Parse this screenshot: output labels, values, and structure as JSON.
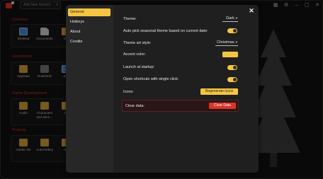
{
  "topbar": {
    "add_section_label": "Add New Section",
    "add_section_chevron": "▾",
    "icons": [
      "grid-icon",
      "gear-icon",
      "minimize-icon",
      "maximize-icon",
      "close-icon"
    ]
  },
  "sections": [
    {
      "title": "Common",
      "items": [
        "Desktop",
        "Documents",
        "Go"
      ]
    },
    {
      "title": "Uncommon",
      "items": [
        "AppData",
        "RustDesk",
        "Ste"
      ]
    },
    {
      "title": "Game Development",
      "items": [
        "Audio",
        "Characters and anim…",
        "Co"
      ]
    },
    {
      "title": "Projects",
      "items": [
        "Adobe XD",
        "AutoHotkey",
        "Ho"
      ]
    }
  ],
  "settings": {
    "nav": [
      "General",
      "Hotkeys",
      "About",
      "Credits"
    ],
    "active_nav": "General",
    "close_glyph": "✕",
    "theme": {
      "label": "Theme:",
      "value": "Dark"
    },
    "seasonal": {
      "label": "Auto pick seasonal theme based on current date:",
      "on": true
    },
    "art_style": {
      "label": "Theme art style:",
      "value": "Christmas"
    },
    "accent": {
      "label": "Accent color:",
      "color": "#f5c542"
    },
    "startup": {
      "label": "Launch at startup:",
      "on": true
    },
    "single_click": {
      "label": "Open shortcuts with single click:",
      "on": true
    },
    "icons": {
      "label": "Icons:",
      "button": "Regenerate Icons"
    },
    "clear": {
      "label": "Clear data:",
      "button": "Clear Data"
    },
    "dropdown_glyph": "▾"
  },
  "colors": {
    "accent": "#f5c542",
    "danger": "#d9342b",
    "section_title": "#d9342b"
  }
}
